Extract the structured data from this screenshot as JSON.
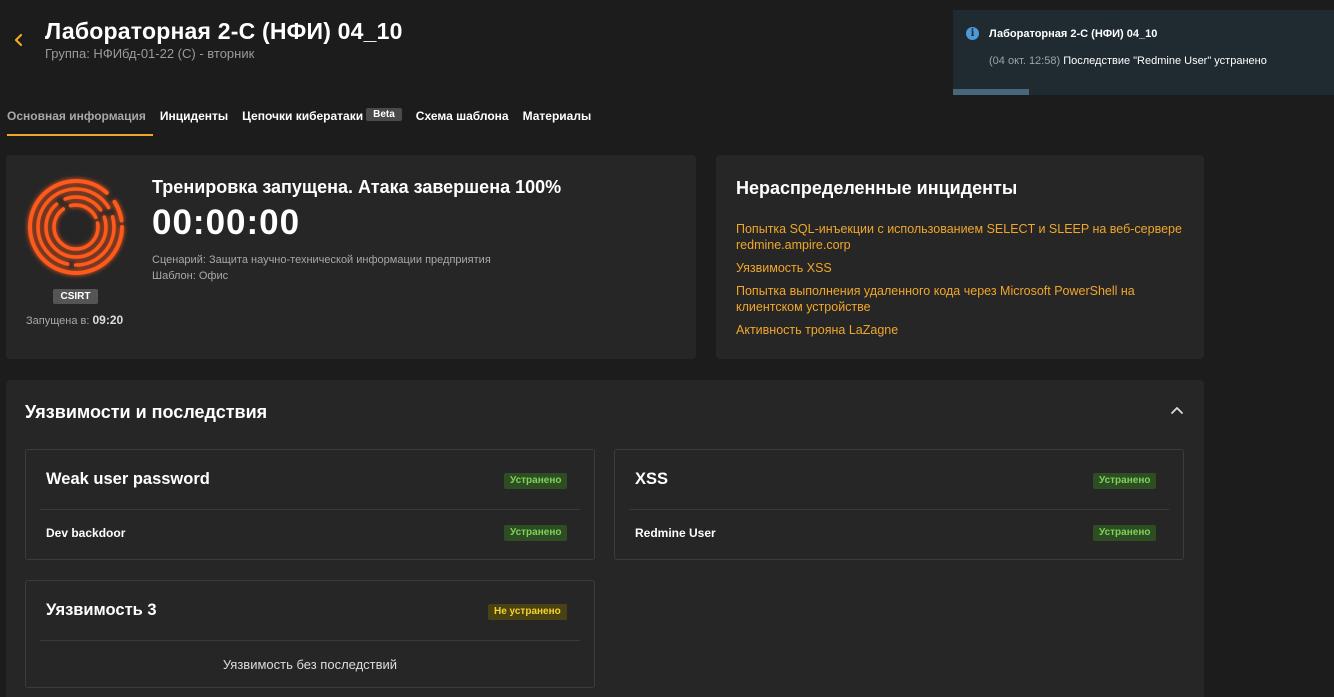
{
  "header": {
    "title": "Лабораторная 2-С (НФИ) 04_10",
    "subtitle": "Группа: НФИбд-01-22 (С) - вторник"
  },
  "toast": {
    "icon": "info-icon",
    "title": "Лабораторная 2-С (НФИ) 04_10",
    "time": "(04 окт. 12:58)",
    "message": "Последствие \"Redmine User\" устранено",
    "progress_fraction": 0.2
  },
  "tabs": [
    {
      "label": "Основная информация",
      "active": true
    },
    {
      "label": "Инциденты"
    },
    {
      "label": "Цепочки кибератаки",
      "badge": "Beta"
    },
    {
      "label": "Схема шаблона"
    },
    {
      "label": "Материалы"
    }
  ],
  "training": {
    "status": "Тренировка запущена. Атака завершена 100%",
    "timer": "00:00:00",
    "scenario": "Сценарий: Защита научно-технической информации предприятия",
    "template": "Шаблон: Офис",
    "team_badge": "CSIRT",
    "started_label": "Запущена в:",
    "started_time": "09:20",
    "accent_color": "#ff5a1f"
  },
  "incidents": {
    "title": "Нераспределенные инциденты",
    "items": [
      "Попытка SQL-инъекции с использованием SELECT и SLEEP на веб-сервере redmine.ampire.corp",
      "Уязвимость XSS",
      "Попытка выполнения удаленного кода через Microsoft PowerShell на клиентском устройстве",
      "Активность трояна LaZagne"
    ]
  },
  "vulnerabilities": {
    "title": "Уязвимости и последствия",
    "items": [
      {
        "name": "Weak user password",
        "status": "Устранено",
        "consequence": "Dev backdoor",
        "consequence_status": "Устранено"
      },
      {
        "name": "XSS",
        "status": "Устранено",
        "consequence": "Redmine User",
        "consequence_status": "Устранено"
      },
      {
        "name": "Уязвимость 3",
        "status": "Не устранено",
        "no_consequences": "Уязвимость без последствий"
      }
    ]
  },
  "colors": {
    "accent": "#f0a62a",
    "background": "#1c1c1c",
    "card": "#262626",
    "status_ok": "#7cd35a",
    "status_bad": "#f5d22a"
  }
}
